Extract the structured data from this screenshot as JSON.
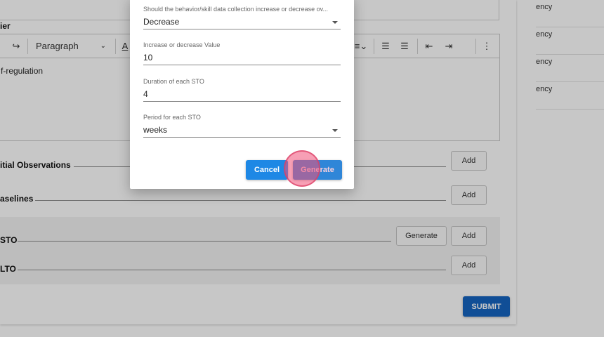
{
  "background": {
    "right_items": [
      "ency",
      "ency",
      "ency",
      "ency"
    ],
    "editor": {
      "section_label": "ier",
      "paragraph_select": "Paragraph",
      "content": "f-regulation"
    },
    "sections": {
      "initial_observations": "itial Observations",
      "baselines": "aselines",
      "sto": "STO",
      "lto": "LTO"
    },
    "buttons": {
      "add": "Add",
      "generate": "Generate",
      "submit": "SUBMIT"
    }
  },
  "modal": {
    "fields": [
      {
        "label": "Should the behavior/skill data collection increase or decrease ov...",
        "value": "Decrease",
        "type": "select"
      },
      {
        "label": "Increase or decrease Value",
        "value": "10",
        "type": "text"
      },
      {
        "label": "Duration of each STO",
        "value": "4",
        "type": "text"
      },
      {
        "label": "Period for each STO",
        "value": "weeks",
        "type": "select"
      }
    ],
    "cancel_label": "Cancel",
    "generate_label": "Generate"
  },
  "colors": {
    "primary": "#1e88e5",
    "submit": "#1565c0",
    "click_marker": "#f05078"
  }
}
